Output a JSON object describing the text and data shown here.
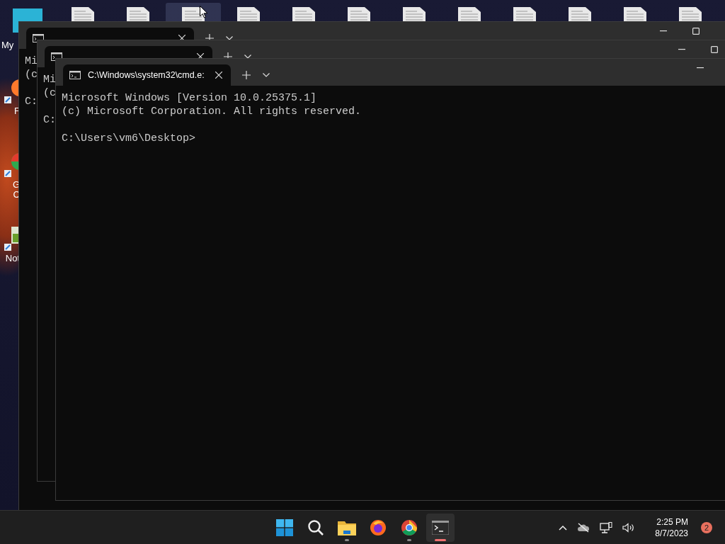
{
  "desktop": {
    "top_icons": [
      {
        "kind": "monitor",
        "label": "My",
        "selected": false
      },
      {
        "kind": "document",
        "selected": false
      },
      {
        "kind": "document",
        "selected": false
      },
      {
        "kind": "document",
        "selected": true
      },
      {
        "kind": "document",
        "selected": false
      },
      {
        "kind": "document",
        "selected": false
      },
      {
        "kind": "document",
        "selected": false
      },
      {
        "kind": "document",
        "selected": false
      },
      {
        "kind": "document",
        "selected": false
      },
      {
        "kind": "document",
        "selected": false
      },
      {
        "kind": "document",
        "selected": false
      },
      {
        "kind": "document",
        "selected": false
      },
      {
        "kind": "document",
        "selected": false
      }
    ],
    "side_icons": [
      {
        "kind": "firefox",
        "label": [
          "F"
        ]
      },
      {
        "kind": "chrome",
        "label": [
          "G",
          "C"
        ]
      },
      {
        "kind": "notepad",
        "label": [
          "Not"
        ]
      }
    ]
  },
  "windows": [
    {
      "controls": [
        {
          "kind": "minimize"
        },
        {
          "kind": "maximize"
        }
      ],
      "paragraphs": [
        [
          "Mi",
          "(c"
        ],
        [
          "C:"
        ]
      ]
    },
    {
      "controls": [
        {
          "kind": "minimize"
        },
        {
          "kind": "maximize"
        }
      ],
      "paragraphs": [
        [
          "Mi",
          "(c"
        ],
        [
          "C:"
        ]
      ]
    },
    {
      "tab_title": "C:\\Windows\\system32\\cmd.e:",
      "controls": [
        {
          "kind": "minimize"
        }
      ],
      "paragraphs": [
        [
          "Microsoft Windows [Version 10.0.25375.1]",
          "(c) Microsoft Corporation. All rights reserved."
        ],
        [
          "C:\\Users\\vm6\\Desktop>"
        ]
      ]
    }
  ],
  "taskbar": {
    "apps": [
      {
        "kind": "start",
        "running": false,
        "active": false
      },
      {
        "kind": "search",
        "running": false,
        "active": false
      },
      {
        "kind": "explorer",
        "running": true,
        "active": false
      },
      {
        "kind": "firefox",
        "running": false,
        "active": false
      },
      {
        "kind": "chrome",
        "running": true,
        "active": false
      },
      {
        "kind": "terminal",
        "running": true,
        "active": true
      }
    ],
    "tray": [
      {
        "kind": "chevron"
      },
      {
        "kind": "cloud-off"
      },
      {
        "kind": "network"
      },
      {
        "kind": "volume"
      }
    ],
    "time": "2:25 PM",
    "date": "8/7/2023",
    "notifications": "2"
  }
}
